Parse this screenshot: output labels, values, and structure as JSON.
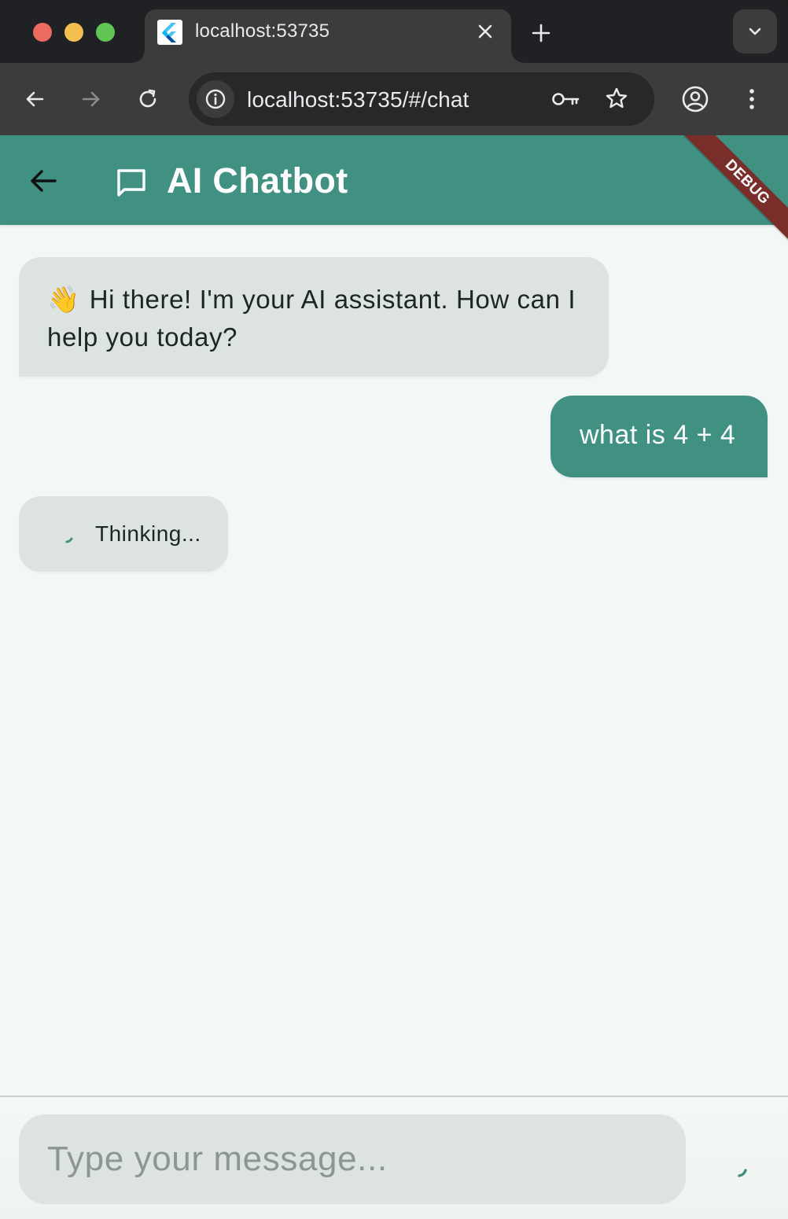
{
  "browser": {
    "tab_title": "localhost:53735",
    "url": "localhost:53735/#/chat"
  },
  "app": {
    "title": "AI Chatbot",
    "debug_banner": "DEBUG",
    "theme_color": "#419183"
  },
  "messages": [
    {
      "role": "bot",
      "emoji": "👋",
      "text": "Hi there! I'm your AI assistant. How can I help you today?"
    },
    {
      "role": "user",
      "text": "what is 4 + 4"
    }
  ],
  "status": {
    "thinking_label": "Thinking..."
  },
  "composer": {
    "placeholder": "Type your message..."
  }
}
